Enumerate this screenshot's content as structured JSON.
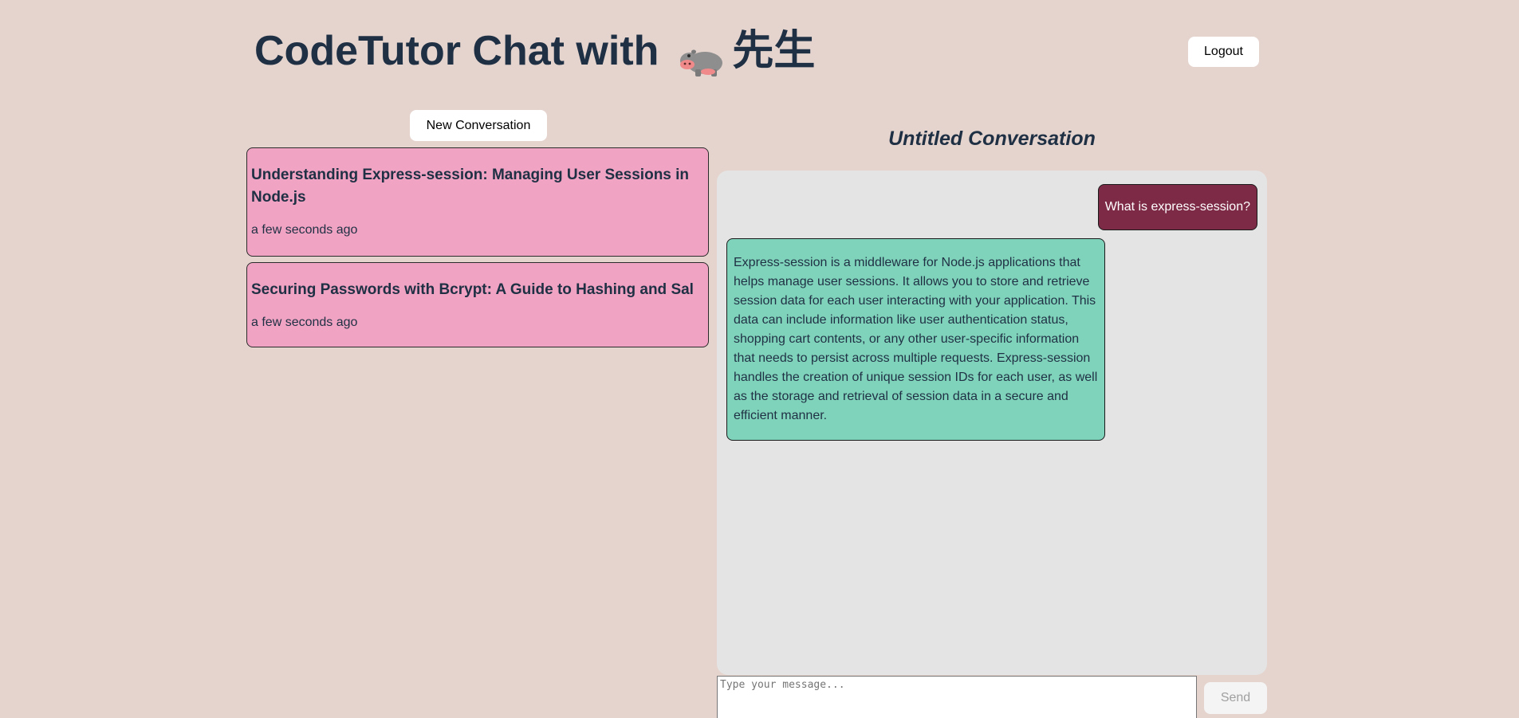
{
  "header": {
    "title_text": "CodeTutor Chat with",
    "title_suffix": "先生",
    "hippo_icon": "hippopotamus-icon",
    "logout_label": "Logout"
  },
  "sidebar": {
    "new_conversation_label": "New Conversation",
    "conversations": [
      {
        "title": "Understanding Express-session: Managing User Sessions in Node.js",
        "time": "a few seconds ago"
      },
      {
        "title": "Securing Passwords with Bcrypt: A Guide to Hashing and Sal",
        "time": "a few seconds ago"
      }
    ]
  },
  "chat": {
    "heading": "Untitled Conversation",
    "messages": [
      {
        "role": "user",
        "text": "What is express-session?"
      },
      {
        "role": "assistant",
        "text": "Express-session is a middleware for Node.js applications that helps manage user sessions. It allows you to store and retrieve session data for each user interacting with your application. This data can include information like user authentication status, shopping cart contents, or any other user-specific information that needs to persist across multiple requests. Express-session handles the creation of unique session IDs for each user, as well as the storage and retrieval of session data in a secure and efficient manner."
      }
    ],
    "input_placeholder": "Type your message...",
    "input_value": "",
    "send_label": "Send"
  },
  "colors": {
    "background": "#e5d4ce",
    "text": "#1f3044",
    "conversation_card": "#f0a3c2",
    "user_bubble": "#7d2a47",
    "assistant_bubble": "#80d3bb",
    "chat_panel": "#e4e4e4"
  }
}
